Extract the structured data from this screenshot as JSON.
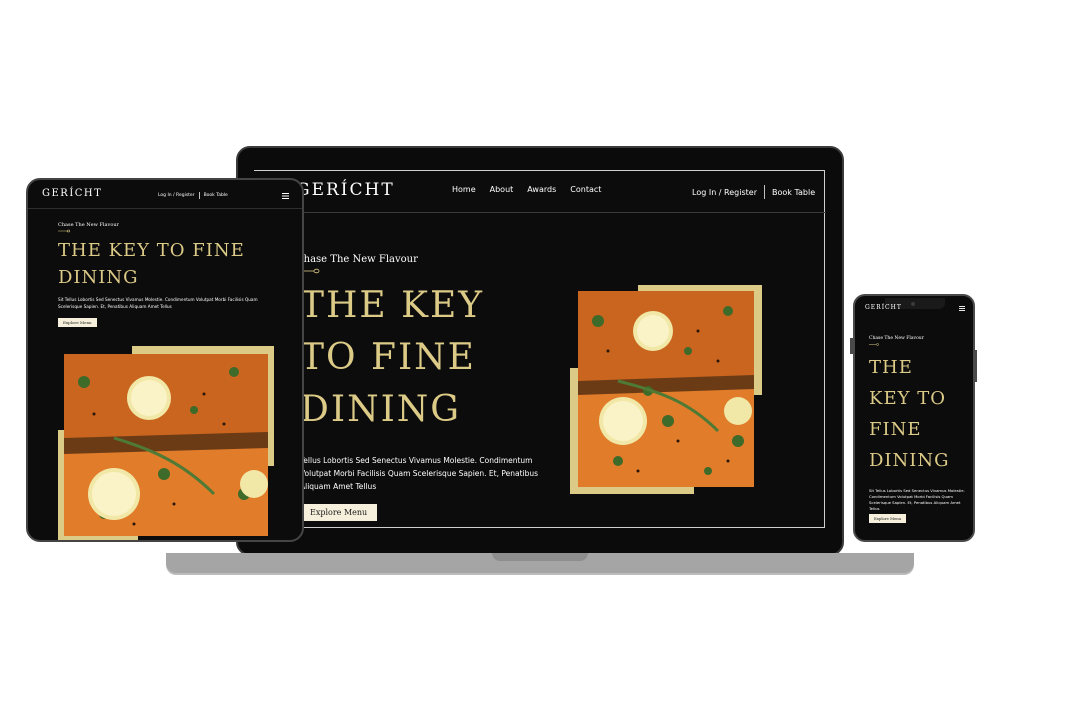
{
  "site": {
    "logo": "GERÍCHT",
    "nav_links": [
      "Home",
      "About",
      "Awards",
      "Contact"
    ],
    "login_label": "Log In / Register",
    "book_label": "Book Table",
    "tagline": "Chase The New Flavour",
    "hero_line1": "THE KEY",
    "hero_line2": "TO FINE",
    "hero_line3": "DINING",
    "hero_tablet_line1": "THE KEY TO FINE",
    "hero_tablet_line2": "DINING",
    "hero_phone_line1": "THE",
    "hero_phone_line2": "KEY TO",
    "hero_phone_line3": "FINE",
    "hero_phone_line4": "DINING",
    "description": "Sit Tellus Lobortis Sed Senectus Vivamus Molestie. Condimentum Volutpat Morbi Facilisis Quam Scelerisque Sapien. Et, Penatibus Aliquam Amet Tellus",
    "laptop_description": "Tellus Lobortis Sed Senectus Vivamus Molestie. Condimentum Volutpat Morbi Facilisis Quam Scelerisque Sapien. Et, Penatibus Aliquam Amet Tellus",
    "cta_label": "Explore Menu"
  },
  "icons": {
    "menu": "hamburger-menu-icon",
    "spoon": "spoon-divider-icon"
  },
  "colors": {
    "gold": "#DCCA87",
    "background": "#0C0C0C",
    "button_bg": "#F5EFDB"
  }
}
